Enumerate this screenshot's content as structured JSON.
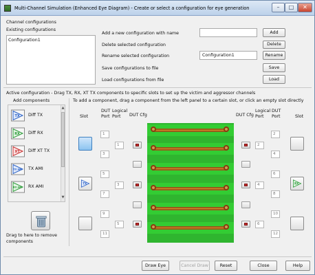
{
  "window": {
    "title": "Multi-Channel Simulation (Enhanced Eye Diagram) - Create or select a configuration for eye generation"
  },
  "config": {
    "section_label": "Channel configurations",
    "existing_label": "Existing configurations",
    "items": [
      "Configuration1"
    ],
    "add_label": "Add a new configuration with name",
    "add_value": "",
    "add_button": "Add",
    "delete_label": "Delete selected configuration",
    "delete_button": "Delete",
    "rename_label": "Rename selected configuration",
    "rename_value": "Configuration1",
    "rename_button": "Rename",
    "save_label": "Save configurations to file",
    "save_button": "Save",
    "load_label": "Load configurations from file",
    "load_button": "Load"
  },
  "active": {
    "header": "Active configuration - Drag TX, RX, XT TX components to specific slots to set up the victim and aggressor channels",
    "add_components_label": "Add components",
    "instructions": "To add a component, drag a component from the left panel to a certain slot, or click an empty slot directly",
    "components": [
      {
        "icon": "TX",
        "label": "Diff TX"
      },
      {
        "icon": "RX",
        "label": "Diff RX"
      },
      {
        "icon": "XT",
        "label": "Diff XT TX"
      },
      {
        "icon": "TX AMI",
        "label": "TX AMI"
      },
      {
        "icon": "RX AMI",
        "label": "RX AMI"
      }
    ],
    "remove_label": "Drag to here to remove components",
    "col_headers": {
      "slot": "Slot",
      "dut_port": "DUT\nPort",
      "logical_port": "Logical\nPort",
      "dut_cfg": "DUT Cfg",
      "dut_cfg_right": "DUT Cfg",
      "logical_port_right": "Logical\nPort",
      "dut_port_right": "DUT\nPort",
      "slot_right": "Slot"
    },
    "left_dut_ports": [
      "1",
      "3",
      "5",
      "7",
      "9",
      "11"
    ],
    "left_logical_ports": [
      "1",
      "3",
      "5"
    ],
    "right_logical_ports": [
      "2",
      "4",
      "6"
    ],
    "right_dut_ports": [
      "2",
      "4",
      "6",
      "8",
      "10",
      "12"
    ],
    "left_slots": [
      "selected-empty",
      "TX",
      "empty"
    ],
    "right_slots": [
      "empty",
      "RX",
      "empty"
    ]
  },
  "footer": {
    "draw_eye": "Draw Eye",
    "cancel_draw": "Cancel Draw",
    "reset": "Reset",
    "close": "Close",
    "help": "Help"
  },
  "colors": {
    "pcb_green": "#33cc33",
    "trace_copper": "#d98c2b",
    "tx_blue": "#2c62c6",
    "rx_green": "#2e9a3a",
    "xt_red": "#c83030"
  }
}
